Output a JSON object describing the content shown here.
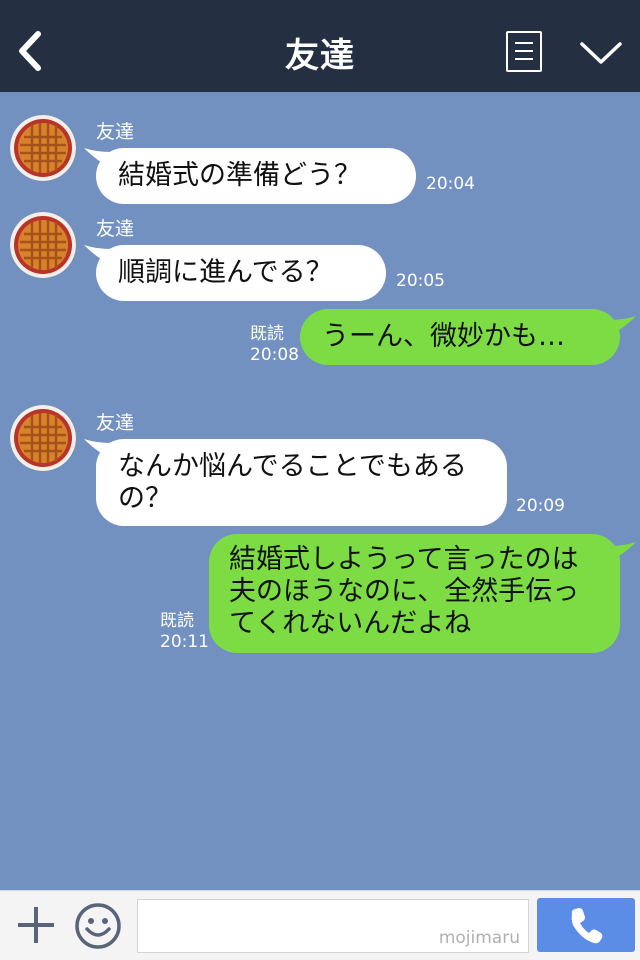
{
  "header": {
    "title": "友達"
  },
  "messages": [
    {
      "side": "left",
      "sender": "友達",
      "text": "結婚式の準備どう？",
      "time": "20:04"
    },
    {
      "side": "left",
      "sender": "友達",
      "text": "順調に進んでる？",
      "time": "20:05"
    },
    {
      "side": "right",
      "read": "既読",
      "text": "うーん、微妙かも…",
      "time": "20:08"
    },
    {
      "side": "left",
      "sender": "友達",
      "text": "なんか悩んでることでもあるの？",
      "time": "20:09"
    },
    {
      "side": "right",
      "read": "既読",
      "text": "結婚式しようって言ったのは夫のほうなのに、全然手伝ってくれないんだよね",
      "time": "20:11"
    }
  ],
  "footer": {
    "watermark": "mojimaru"
  },
  "colors": {
    "header_bg": "#243042",
    "chat_bg": "#7290c0",
    "sent_bubble": "#7ddc44",
    "received_bubble": "#ffffff",
    "call_button": "#5b8ce6"
  },
  "icons": [
    "back-arrow-icon",
    "menu-list-icon",
    "chevron-down-icon",
    "plus-icon",
    "smiley-icon",
    "phone-icon"
  ]
}
